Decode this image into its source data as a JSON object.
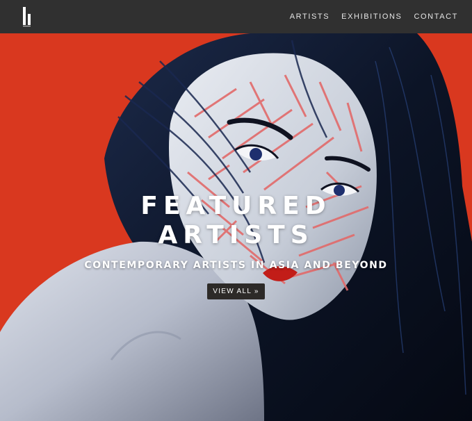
{
  "header": {
    "logo_icon": "gallery-logo-icon",
    "nav": [
      {
        "label": "ARTISTS"
      },
      {
        "label": "EXHIBITIONS"
      },
      {
        "label": "CONTACT"
      }
    ]
  },
  "hero": {
    "title_line1": "FEATURED",
    "title_line2": "ARTISTS",
    "subtitle": "CONTEMPORARY ARTISTS IN ASIA AND BEYOND",
    "button_label": "VIEW ALL »",
    "background_color": "#d9381f",
    "image": "painting-of-woman-with-dark-hair-and-red-line-pattern-on-face"
  },
  "colors": {
    "navbar": "#303030",
    "accent_red": "#d9381f",
    "button_bg": "#2d2a28"
  }
}
